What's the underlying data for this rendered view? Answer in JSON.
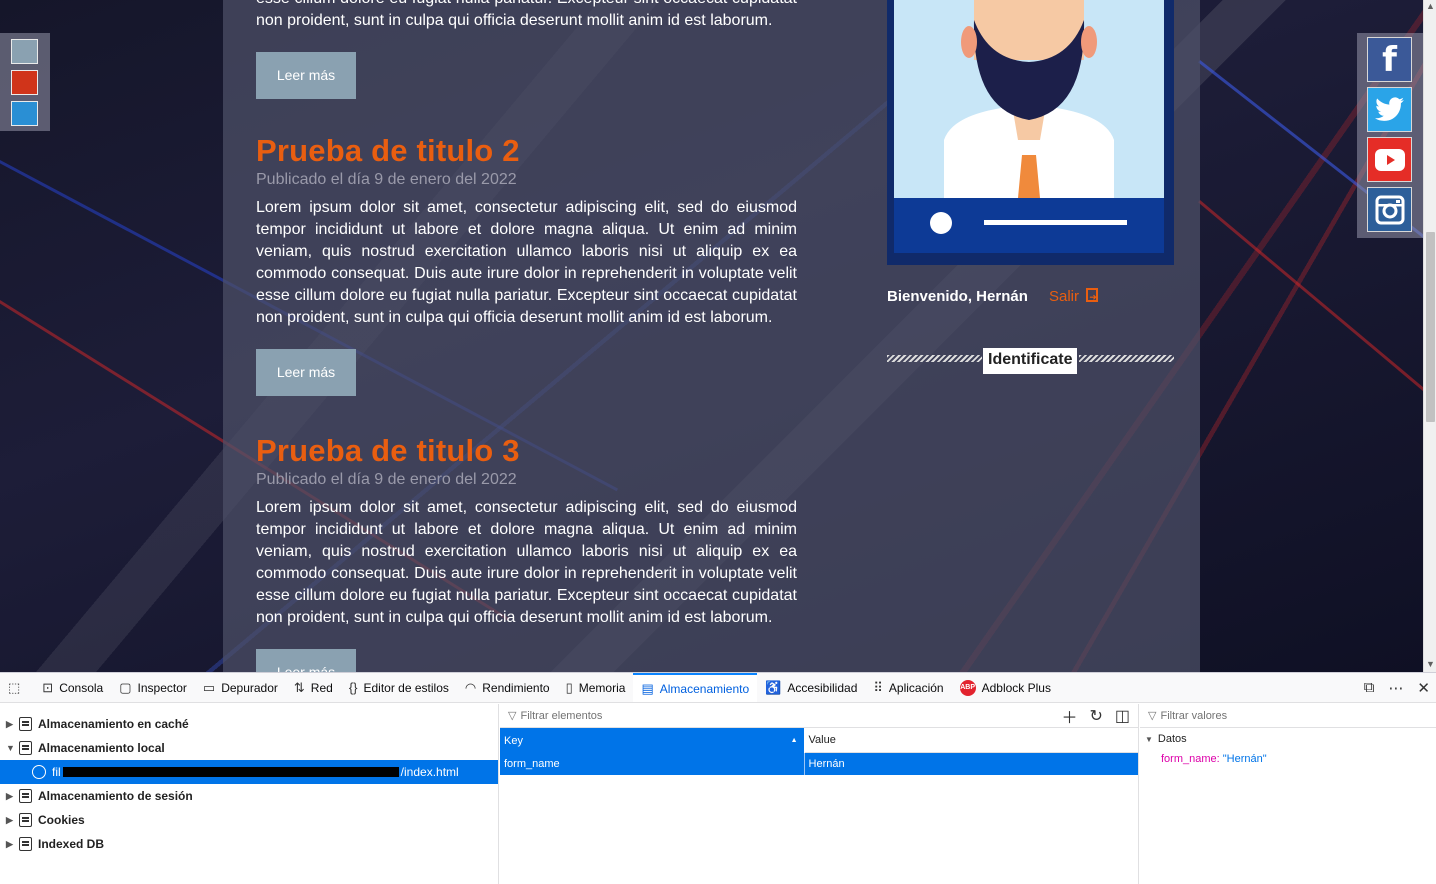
{
  "page": {
    "theme_colors": [
      "#8aa1b1",
      "#d0341a",
      "#2a8fd4"
    ],
    "posts": [
      {
        "title": "",
        "date": "",
        "body_tail": "esse cillum dolore eu fugiat nulla pariatur. Excepteur sint occaecat cupidatat non proident, sunt in culpa qui officia deserunt mollit anim id est laborum.",
        "read_more": "Leer más"
      },
      {
        "title": "Prueba de titulo 2",
        "date": "Publicado el día 9 de enero del 2022",
        "body": "Lorem ipsum dolor sit amet, consectetur adipiscing elit, sed do eiusmod tempor incididunt ut labore et dolore magna aliqua. Ut enim ad minim veniam, quis nostrud exercitation ullamco laboris nisi ut aliquip ex ea commodo consequat. Duis aute irure dolor in reprehenderit in voluptate velit esse cillum dolore eu fugiat nulla pariatur. Excepteur sint occaecat cupidatat non proident, sunt in culpa qui officia deserunt mollit anim id est laborum.",
        "read_more": "Leer más"
      },
      {
        "title": "Prueba de titulo 3",
        "date": "Publicado el día 9 de enero del 2022",
        "body": "Lorem ipsum dolor sit amet, consectetur adipiscing elit, sed do eiusmod tempor incididunt ut labore et dolore magna aliqua. Ut enim ad minim veniam, quis nostrud exercitation ullamco laboris nisi ut aliquip ex ea commodo consequat. Duis aute irure dolor in reprehenderit in voluptate velit esse cillum dolore eu fugiat nulla pariatur. Excepteur sint occaecat cupidatat non proident, sunt in culpa qui officia deserunt mollit anim id est laborum.",
        "read_more": "Leer más"
      }
    ],
    "sidebar": {
      "welcome": "Bienvenido, Hernán",
      "logout": "Salir",
      "identify": "Identificate"
    },
    "social": [
      {
        "name": "facebook-icon",
        "glyph": "f",
        "color": "#3b5998"
      },
      {
        "name": "twitter-icon",
        "glyph": "🐦",
        "color": "#2aa4e8"
      },
      {
        "name": "youtube-icon",
        "glyph": "▶",
        "color": "#e52d27"
      },
      {
        "name": "instagram-icon",
        "glyph": "◎",
        "color": "#2d5f9a"
      }
    ]
  },
  "devtools": {
    "tabs": [
      {
        "label": "Consola",
        "icon": "console-icon"
      },
      {
        "label": "Inspector",
        "icon": "inspector-icon"
      },
      {
        "label": "Depurador",
        "icon": "debugger-icon"
      },
      {
        "label": "Red",
        "icon": "network-icon"
      },
      {
        "label": "Editor de estilos",
        "icon": "style-editor-icon"
      },
      {
        "label": "Rendimiento",
        "icon": "performance-icon"
      },
      {
        "label": "Memoria",
        "icon": "memory-icon"
      },
      {
        "label": "Almacenamiento",
        "icon": "storage-icon"
      },
      {
        "label": "Accesibilidad",
        "icon": "accessibility-icon"
      },
      {
        "label": "Aplicación",
        "icon": "application-icon"
      },
      {
        "label": "Adblock Plus",
        "icon": "adblock-plus-icon"
      }
    ],
    "active_tab": "Almacenamiento",
    "tree": [
      {
        "label": "Almacenamiento en caché",
        "expanded": false
      },
      {
        "label": "Almacenamiento local",
        "expanded": true
      },
      {
        "label": "Almacenamiento de sesión",
        "expanded": false
      },
      {
        "label": "Cookies",
        "expanded": false
      },
      {
        "label": "Indexed DB",
        "expanded": false
      }
    ],
    "selected_origin_prefix": "fil",
    "selected_origin_suffix": "/index.html",
    "filter_items_placeholder": "Filtrar elementos",
    "filter_values_placeholder": "Filtrar valores",
    "columns": [
      "Key",
      "Value"
    ],
    "rows": [
      {
        "key": "form_name",
        "value": "Hernán"
      }
    ],
    "data_section": "Datos",
    "data_entry_key": "form_name:",
    "data_entry_value": "\"Hernán\""
  }
}
